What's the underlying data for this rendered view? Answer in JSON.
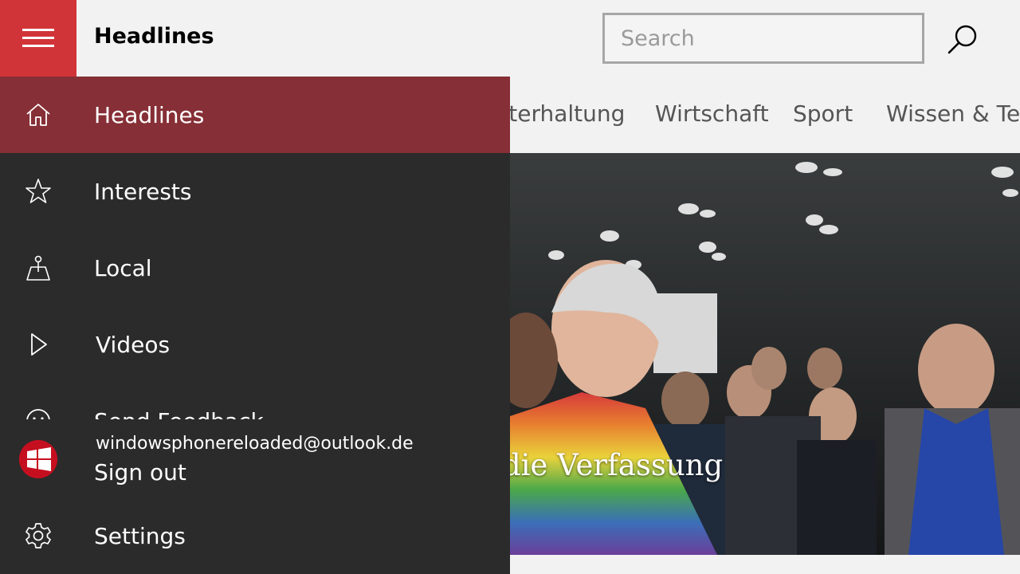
{
  "header": {
    "title": "Headlines",
    "search_placeholder": "Search",
    "accent_color": "#d13438"
  },
  "tabs": [
    {
      "label": "Unterhaltung"
    },
    {
      "label": "Wirtschaft"
    },
    {
      "label": "Sport"
    },
    {
      "label": "Wissen & Technik"
    }
  ],
  "hero": {
    "caption": "die Verfassung"
  },
  "nav": {
    "items": [
      {
        "label": "Headlines",
        "icon": "home-icon",
        "selected": true
      },
      {
        "label": "Interests",
        "icon": "star-icon",
        "selected": false
      },
      {
        "label": "Local",
        "icon": "local-icon",
        "selected": false
      },
      {
        "label": "Videos",
        "icon": "play-icon",
        "selected": false
      },
      {
        "label": "Send Feedback",
        "icon": "smiley-icon",
        "selected": false
      }
    ],
    "selected_color": "#862f36",
    "pane_color": "#2b2b2b"
  },
  "account": {
    "email": "windowsphonereloaded@outlook.de",
    "sign_out_label": "Sign out"
  },
  "settings": {
    "label": "Settings",
    "icon": "gear-icon"
  }
}
